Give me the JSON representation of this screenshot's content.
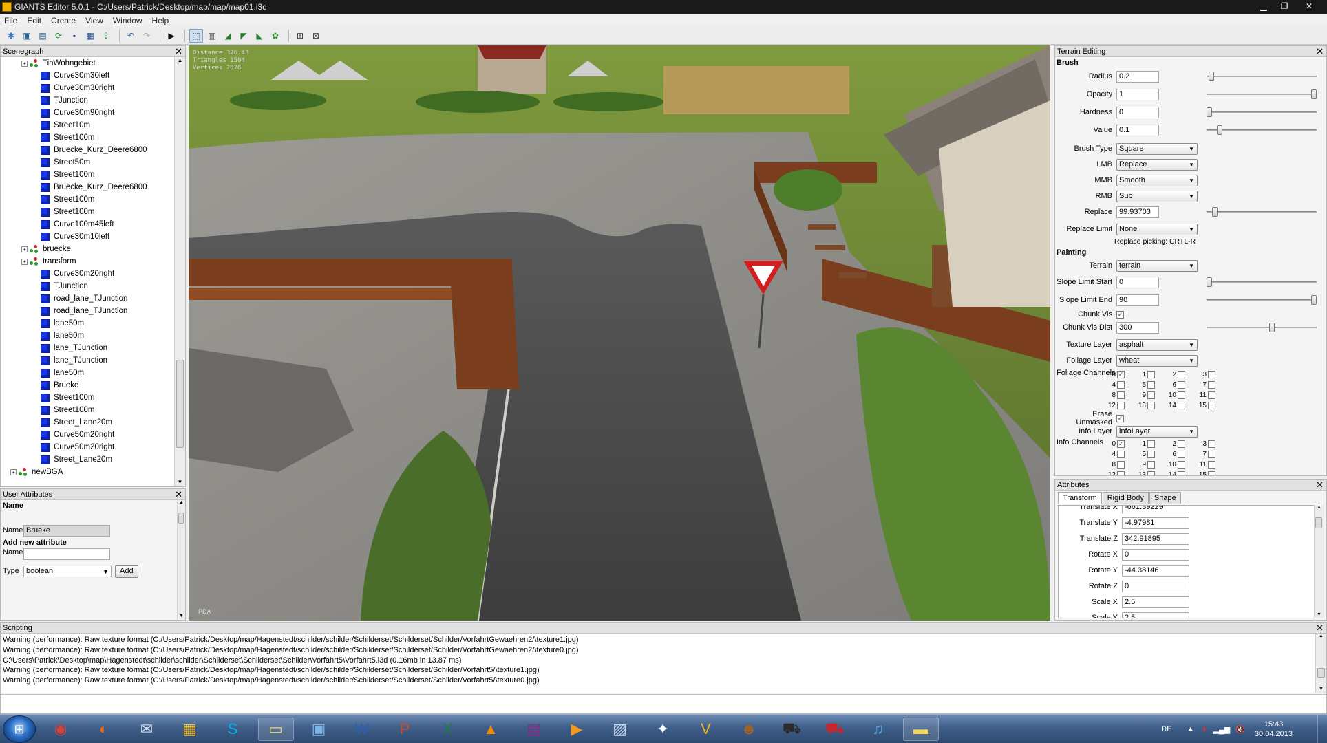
{
  "window": {
    "title": "GIANTS Editor 5.0.1 - C:/Users/Patrick/Desktop/map/map/map01.i3d",
    "min": "▁",
    "max": "❐",
    "close": "✕"
  },
  "menu": [
    "File",
    "Edit",
    "Create",
    "View",
    "Window",
    "Help"
  ],
  "scenegraph": {
    "title": "Scenegraph",
    "items": [
      {
        "label": "TinWohngebiet",
        "kind": "group",
        "indent": 2,
        "expander": "+"
      },
      {
        "label": "Curve30m30left",
        "kind": "shape",
        "indent": 3
      },
      {
        "label": "Curve30m30right",
        "kind": "shape",
        "indent": 3
      },
      {
        "label": "TJunction",
        "kind": "shape",
        "indent": 3
      },
      {
        "label": "Curve30m90right",
        "kind": "shape",
        "indent": 3
      },
      {
        "label": "Street10m",
        "kind": "shape",
        "indent": 3
      },
      {
        "label": "Street100m",
        "kind": "shape",
        "indent": 3
      },
      {
        "label": "Bruecke_Kurz_Deere6800",
        "kind": "shape",
        "indent": 3
      },
      {
        "label": "Street50m",
        "kind": "shape",
        "indent": 3
      },
      {
        "label": "Street100m",
        "kind": "shape",
        "indent": 3
      },
      {
        "label": "Bruecke_Kurz_Deere6800",
        "kind": "shape",
        "indent": 3
      },
      {
        "label": "Street100m",
        "kind": "shape",
        "indent": 3
      },
      {
        "label": "Street100m",
        "kind": "shape",
        "indent": 3
      },
      {
        "label": "Curve100m45left",
        "kind": "shape",
        "indent": 3
      },
      {
        "label": "Curve30m10left",
        "kind": "shape",
        "indent": 3
      },
      {
        "label": "bruecke",
        "kind": "group",
        "indent": 2,
        "expander": "+"
      },
      {
        "label": "transform",
        "kind": "group",
        "indent": 2,
        "expander": "+"
      },
      {
        "label": "Curve30m20right",
        "kind": "shape",
        "indent": 3
      },
      {
        "label": "TJunction",
        "kind": "shape",
        "indent": 3
      },
      {
        "label": "road_lane_TJunction",
        "kind": "shape",
        "indent": 3
      },
      {
        "label": "road_lane_TJunction",
        "kind": "shape",
        "indent": 3
      },
      {
        "label": "lane50m",
        "kind": "shape",
        "indent": 3
      },
      {
        "label": "lane50m",
        "kind": "shape",
        "indent": 3
      },
      {
        "label": "lane_TJunction",
        "kind": "shape",
        "indent": 3
      },
      {
        "label": "lane_TJunction",
        "kind": "shape",
        "indent": 3
      },
      {
        "label": "lane50m",
        "kind": "shape",
        "indent": 3
      },
      {
        "label": "Brueke",
        "kind": "shape",
        "indent": 3
      },
      {
        "label": "Street100m",
        "kind": "shape",
        "indent": 3
      },
      {
        "label": "Street100m",
        "kind": "shape",
        "indent": 3
      },
      {
        "label": "Street_Lane20m",
        "kind": "shape",
        "indent": 3
      },
      {
        "label": "Curve50m20right",
        "kind": "shape",
        "indent": 3
      },
      {
        "label": "Curve50m20right",
        "kind": "shape",
        "indent": 3
      },
      {
        "label": "Street_Lane20m",
        "kind": "shape",
        "indent": 3
      },
      {
        "label": "newBGA",
        "kind": "group",
        "indent": 1,
        "expander": "+"
      }
    ]
  },
  "user_attributes": {
    "title": "User Attributes",
    "name_header": "Name",
    "name_label": "Name",
    "name_value": "Brueke",
    "add_header": "Add new attribute",
    "new_name_label": "Name",
    "new_name_value": "",
    "type_label": "Type",
    "type_value": "boolean",
    "add_button": "Add"
  },
  "viewport": {
    "stats": [
      "Distance 326.43",
      "Triangles 1504",
      "Vertices 2676"
    ],
    "footer": "PDA"
  },
  "terrain": {
    "title": "Terrain Editing",
    "brush_header": "Brush",
    "radius_label": "Radius",
    "radius": "0.2",
    "opacity_label": "Opacity",
    "opacity": "1",
    "hardness_label": "Hardness",
    "hardness": "0",
    "value_label": "Value",
    "value": "0.1",
    "brush_type_label": "Brush Type",
    "brush_type": "Square",
    "lmb_label": "LMB",
    "lmb": "Replace",
    "mmb_label": "MMB",
    "mmb": "Smooth",
    "rmb_label": "RMB",
    "rmb": "Sub",
    "replace_label": "Replace",
    "replace": "99.93703",
    "replace_limit_label": "Replace Limit",
    "replace_limit": "None",
    "replace_picking": "Replace picking: CRTL-R",
    "painting_header": "Painting",
    "terrain_label": "Terrain",
    "terrain": "terrain",
    "slope_start_label": "Slope Limit Start",
    "slope_start": "0",
    "slope_end_label": "Slope Limit End",
    "slope_end": "90",
    "chunk_vis_label": "Chunk Vis",
    "chunk_vis": true,
    "chunk_vis_dist_label": "Chunk Vis Dist",
    "chunk_vis_dist": "300",
    "texture_layer_label": "Texture Layer",
    "texture_layer": "asphalt",
    "foliage_layer_label": "Foliage Layer",
    "foliage_layer": "wheat",
    "foliage_channels_label": "Foliage Channels",
    "erase_unmasked_label": "Erase Unmasked",
    "erase_unmasked": true,
    "info_layer_label": "Info Layer",
    "info_layer": "infoLayer",
    "info_channels_label": "Info Channels",
    "sliders": {
      "radius": 0.02,
      "opacity": 1.0,
      "hardness": 0.0,
      "value": 0.1,
      "replace": 0.05,
      "slope_start": 0.0,
      "slope_end": 1.0,
      "chunk_vis_dist": 0.6
    }
  },
  "attributes": {
    "title": "Attributes",
    "tabs": [
      "Transform",
      "Rigid Body",
      "Shape"
    ],
    "rows": [
      {
        "label": "Translate X",
        "value": "-661.39229"
      },
      {
        "label": "Translate Y",
        "value": "-4.97981"
      },
      {
        "label": "Translate Z",
        "value": "342.91895"
      },
      {
        "label": "Rotate X",
        "value": "0"
      },
      {
        "label": "Rotate Y",
        "value": "-44.38146"
      },
      {
        "label": "Rotate Z",
        "value": "0"
      },
      {
        "label": "Scale X",
        "value": "2.5"
      },
      {
        "label": "Scale Y",
        "value": "2.5"
      }
    ]
  },
  "scripting": {
    "title": "Scripting",
    "lines": [
      "Warning (performance): Raw texture format (C:/Users/Patrick/Desktop/map/Hagenstedt/schilder/schilder/Schilderset/Schilderset/Schilder/VorfahrtGewaehren2/\\texture1.jpg)",
      "Warning (performance): Raw texture format (C:/Users/Patrick/Desktop/map/Hagenstedt/schilder/schilder/Schilderset/Schilderset/Schilder/VorfahrtGewaehren2/\\texture0.jpg)",
      "C:\\Users\\Patrick\\Desktop\\map\\Hagenstedt\\schilder\\schilder\\Schilderset\\Schilderset\\Schilder\\Vorfahrt5\\Vorfahrt5.i3d (0.16mb in 13.87 ms)",
      "Warning (performance): Raw texture format (C:/Users/Patrick/Desktop/map/Hagenstedt/schilder/schilder/Schilderset/Schilderset/Schilder/Vorfahrt5/\\texture1.jpg)",
      "Warning (performance): Raw texture format (C:/Users/Patrick/Desktop/map/Hagenstedt/schilder/schilder/Schilderset/Schilderset/Schilder/Vorfahrt5/\\texture0.jpg)"
    ]
  },
  "taskbar": {
    "apps": [
      {
        "name": "chrome-icon",
        "glyph": "◉",
        "color": "#d8403a"
      },
      {
        "name": "firefox-icon",
        "glyph": "◐",
        "color": "#e86a1c"
      },
      {
        "name": "thunderbird-icon",
        "glyph": "✉",
        "color": "#d9e4f2"
      },
      {
        "name": "media-center-icon",
        "glyph": "▦",
        "color": "#f3c23a"
      },
      {
        "name": "skype-icon",
        "glyph": "S",
        "color": "#00aff0"
      },
      {
        "name": "explorer-icon",
        "glyph": "▭",
        "color": "#f1d376"
      },
      {
        "name": "network-icon",
        "glyph": "▣",
        "color": "#7db3e8"
      },
      {
        "name": "word-icon",
        "glyph": "W",
        "color": "#2b5fb3"
      },
      {
        "name": "powerpoint-icon",
        "glyph": "P",
        "color": "#d24726"
      },
      {
        "name": "excel-icon",
        "glyph": "X",
        "color": "#1e7b45"
      },
      {
        "name": "vlc-icon",
        "glyph": "▲",
        "color": "#f28a00"
      },
      {
        "name": "winrar-icon",
        "glyph": "▤",
        "color": "#8a2a8a"
      },
      {
        "name": "media-player-icon",
        "glyph": "▶",
        "color": "#f39a1e"
      },
      {
        "name": "remote-icon",
        "glyph": "▨",
        "color": "#c6d8ee"
      },
      {
        "name": "gimp-icon",
        "glyph": "✦",
        "color": "#ffffff"
      },
      {
        "name": "cad-icon",
        "glyph": "V",
        "color": "#f3b61b"
      },
      {
        "name": "game-icon",
        "glyph": "☻",
        "color": "#a0642a"
      },
      {
        "name": "tractor-icon",
        "glyph": "⛟",
        "color": "#2b2b2b"
      },
      {
        "name": "ls-game-icon",
        "glyph": "⛟",
        "color": "#c8252a"
      },
      {
        "name": "itunes-icon",
        "glyph": "♫",
        "color": "#4aa8f0"
      },
      {
        "name": "giants-editor-icon",
        "glyph": "▬",
        "color": "#f3d45a"
      }
    ],
    "lang": "DE",
    "time": "15:43",
    "date": "30.04.2013"
  }
}
